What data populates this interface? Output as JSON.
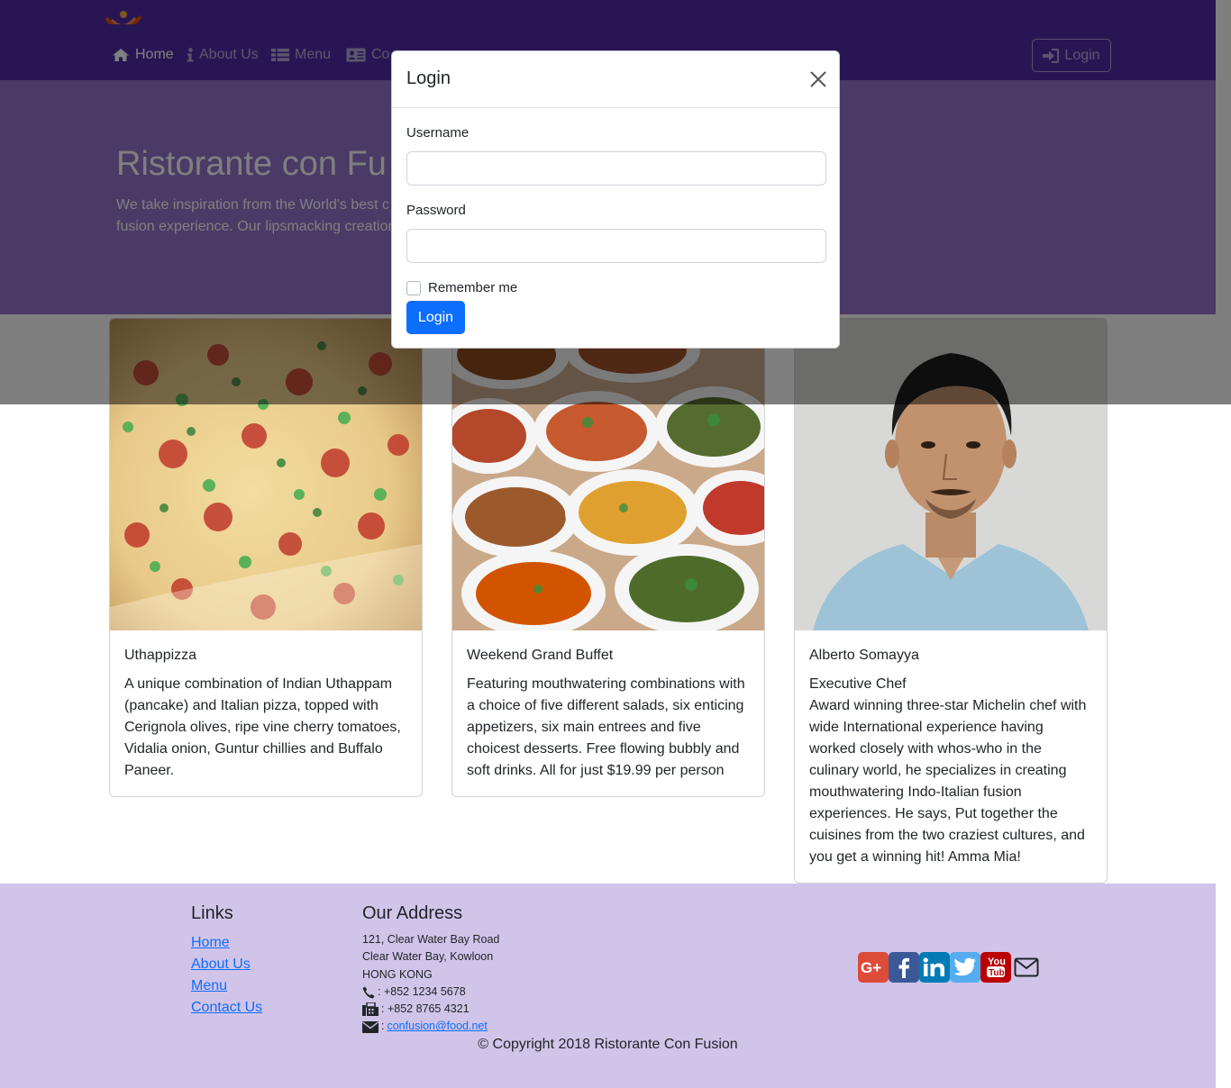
{
  "brand": {
    "accent": "#512da8",
    "jumbotron_bg": "#9575cd",
    "footer_bg": "#d1c4e9",
    "primary": "#0d6efd"
  },
  "nav": {
    "items": [
      {
        "label": "Home",
        "icon": "home-icon",
        "active": true
      },
      {
        "label": "About Us",
        "icon": "info-icon",
        "active": false
      },
      {
        "label": "Menu",
        "icon": "list-icon",
        "active": false
      },
      {
        "label": "Co",
        "icon": "address-card-icon",
        "active": false
      }
    ],
    "login_label": "Login"
  },
  "jumbotron": {
    "title": "Ristorante con Fu",
    "text_line1": "We take inspiration from the World's best c",
    "text_line2": "fusion experience. Our lipsmacking creation"
  },
  "cards": [
    {
      "title": "Uthappizza",
      "image": "pizza-image",
      "text": "A unique combination of Indian Uthappam (pancake) and Italian pizza, topped with Cerignola olives, ripe vine cherry tomatoes, Vidalia onion, Guntur chillies and Buffalo Paneer."
    },
    {
      "title": "Weekend Grand Buffet",
      "image": "buffet-image",
      "text": "Featuring mouthwatering combinations with a choice of five different salads, six enticing appetizers, six main entrees and five choicest desserts. Free flowing bubbly and soft drinks. All for just $19.99 per person"
    },
    {
      "title": "Alberto Somayya",
      "subtitle": "Executive Chef",
      "image": "chef-photo",
      "text": "Award winning three-star Michelin chef with wide International experience having worked closely with whos-who in the culinary world, he specializes in creating mouthwatering Indo-Italian fusion experiences. He says, Put together the cuisines from the two craziest cultures, and you get a winning hit! Amma Mia!"
    }
  ],
  "footer": {
    "links_heading": "Links",
    "links": [
      "Home",
      "About Us",
      "Menu",
      "Contact Us"
    ],
    "address_heading": "Our Address",
    "address_lines": [
      "121, Clear Water Bay Road",
      "Clear Water Bay, Kowloon",
      "HONG KONG"
    ],
    "phone": ": +852 1234 5678",
    "fax": ": +852 8765 4321",
    "email": "confusion@food.net",
    "social": [
      {
        "icon": "google-plus-icon",
        "color": "#dd4b39"
      },
      {
        "icon": "facebook-icon",
        "color": "#3b5998"
      },
      {
        "icon": "linkedin-icon",
        "color": "#007bb6"
      },
      {
        "icon": "twitter-icon",
        "color": "#55acee"
      },
      {
        "icon": "youtube-icon",
        "color": "#bb0000"
      },
      {
        "icon": "envelope-icon",
        "color": "#212529"
      }
    ],
    "copyright": "© Copyright 2018 Ristorante Con Fusion"
  },
  "modal": {
    "title": "Login",
    "username_label": "Username",
    "username_value": "",
    "password_label": "Password",
    "password_value": "",
    "remember_label": "Remember me",
    "remember_checked": false,
    "submit_label": "Login"
  }
}
